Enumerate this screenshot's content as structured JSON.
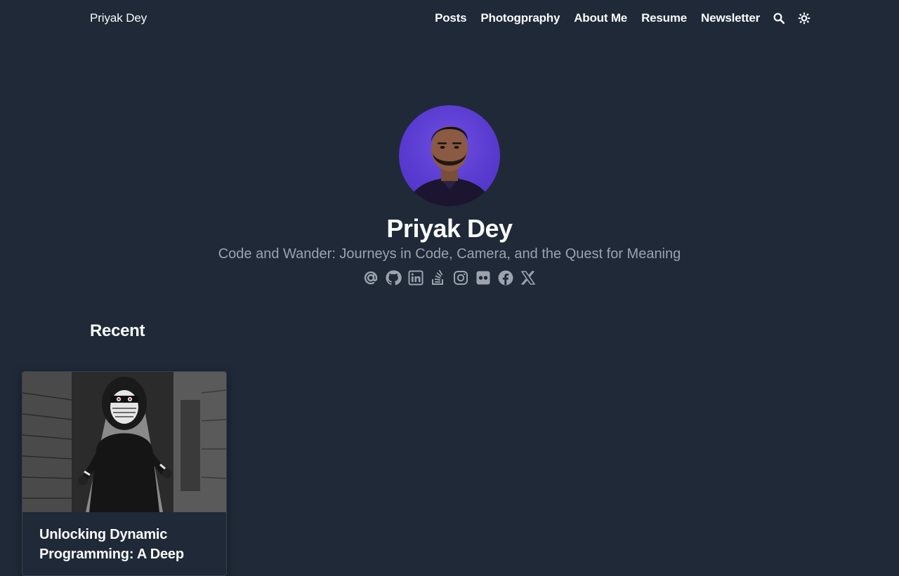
{
  "header": {
    "brand": "Priyak Dey",
    "nav": [
      {
        "label": "Posts"
      },
      {
        "label": "Photogpraphy"
      },
      {
        "label": "About Me"
      },
      {
        "label": "Resume"
      },
      {
        "label": "Newsletter"
      }
    ],
    "icons": [
      "search-icon",
      "theme-toggle-icon"
    ]
  },
  "hero": {
    "name": "Priyak Dey",
    "tagline": "Code and Wander: Journeys in Code, Camera, and the Quest for Meaning",
    "socials": [
      "email-icon",
      "github-icon",
      "linkedin-icon",
      "stackoverflow-icon",
      "instagram-icon",
      "flickr-icon",
      "facebook-icon",
      "x-twitter-icon"
    ]
  },
  "recent": {
    "title": "Recent",
    "posts": [
      {
        "title": "Unlocking Dynamic Programming: A Deep"
      }
    ]
  },
  "colors": {
    "background": "#1f2937",
    "text": "#f9fafb",
    "muted": "#9ca3af",
    "avatar_bg": "#5a3bd0"
  }
}
